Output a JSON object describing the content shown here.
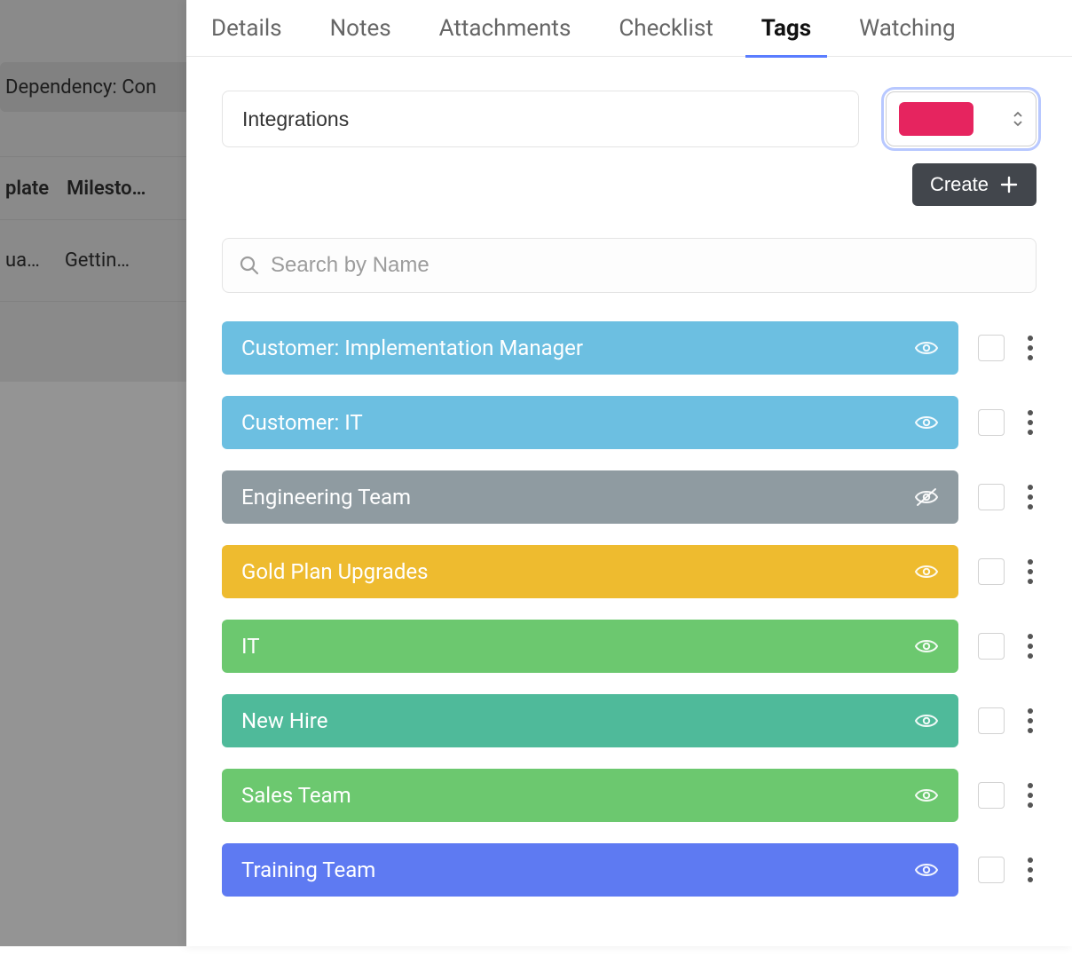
{
  "background": {
    "pill_text": "Dependency: Con",
    "row1_cols": [
      "plate",
      "Milesto…"
    ],
    "row2_cols": [
      "ua…",
      "Gettin…"
    ]
  },
  "tabs": [
    {
      "label": "Details",
      "active": false
    },
    {
      "label": "Notes",
      "active": false
    },
    {
      "label": "Attachments",
      "active": false
    },
    {
      "label": "Checklist",
      "active": false
    },
    {
      "label": "Tags",
      "active": true
    },
    {
      "label": "Watching",
      "active": false
    }
  ],
  "new_tag": {
    "name": "Integrations",
    "color": "#e6245f"
  },
  "create_label": "Create",
  "search": {
    "placeholder": "Search by Name",
    "value": ""
  },
  "tags": [
    {
      "label": "Customer: Implementation Manager",
      "color": "#6cbfe1",
      "visible": true
    },
    {
      "label": "Customer: IT",
      "color": "#6cbfe1",
      "visible": true
    },
    {
      "label": "Engineering Team",
      "color": "#8f9ba1",
      "visible": false
    },
    {
      "label": "Gold Plan Upgrades",
      "color": "#eebb2f",
      "visible": true
    },
    {
      "label": "IT",
      "color": "#6cc86f",
      "visible": true
    },
    {
      "label": "New Hire",
      "color": "#4fba9a",
      "visible": true
    },
    {
      "label": "Sales Team",
      "color": "#6cc86f",
      "visible": true
    },
    {
      "label": "Training Team",
      "color": "#5e7af2",
      "visible": true
    }
  ]
}
